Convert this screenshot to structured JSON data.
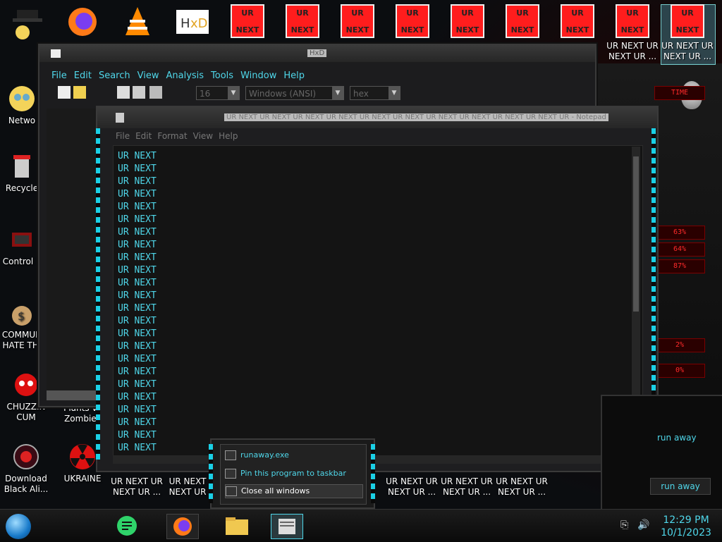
{
  "desktop": {
    "top_row_tiles": [
      "UR",
      "NEXT"
    ],
    "top_labels": [
      {
        "line1": "UR NEXT UR",
        "line2": "NEXT UR ..."
      },
      {
        "line1": "UR NEXT UR",
        "line2": "NEXT UR ..."
      }
    ],
    "left_icons": [
      {
        "label": "Netwo"
      },
      {
        "label": "Recycle"
      },
      {
        "label": "Control P"
      },
      {
        "label": "COMMUN",
        "label2": "HATE THI"
      },
      {
        "label": "CHUZZIN",
        "label2": "CUM"
      },
      {
        "label": "Plants vs",
        "label2": "Zombies"
      },
      {
        "label": "Download",
        "label2": "Black Ali..."
      },
      {
        "label": "UKRAINE"
      }
    ],
    "bottom_labels": [
      {
        "line1": "UR NEXT UR",
        "line2": "NEXT UR ..."
      },
      {
        "line1": "UR NEXT",
        "line2": "NEXT UR"
      },
      {
        "line1": "UR NEXT UR",
        "line2": "NEXT UR ..."
      },
      {
        "line1": "UR NEXT UR",
        "line2": "NEXT UR ..."
      },
      {
        "line1": "UR NEXT UR",
        "line2": "NEXT UR ..."
      }
    ],
    "right_panel": {
      "time_label": "TIME",
      "pct1": "63%",
      "pct2": "64%",
      "pct3": "87%",
      "pct4": "2%",
      "pct5": "0%"
    },
    "run_away_label": "run away",
    "run_away_button": "run away"
  },
  "hex_editor": {
    "title": "HxD",
    "menu": [
      "File",
      "Edit",
      "Search",
      "View",
      "Analysis",
      "Tools",
      "Window",
      "Help"
    ],
    "bytes_per_row": "16",
    "charset": "Windows (ANSI)",
    "offset_base": "hex"
  },
  "notepad": {
    "title": "UR NEXT UR NEXT UR NEXT UR NEXT UR NEXT UR NEXT UR NEXT UR NEXT UR NEXT UR NEXT UR - Notepad",
    "menu": [
      "File",
      "Edit",
      "Format",
      "View",
      "Help"
    ],
    "lines": [
      "UR NEXT",
      "UR NEXT",
      "UR NEXT",
      "UR NEXT",
      "UR NEXT",
      "UR NEXT",
      "UR NEXT",
      "UR NEXT",
      "UR NEXT",
      "UR NEXT",
      "UR NEXT",
      "UR NEXT",
      "UR NEXT",
      "UR NEXT",
      "UR NEXT",
      "UR NEXT",
      "UR NEXT",
      "UR NEXT",
      "UR NEXT",
      "UR NEXT",
      "UR NEXT",
      "UR NEXT",
      "UR NEXT",
      "UR NEXT"
    ]
  },
  "jump_list": {
    "items": [
      {
        "label": "runaway.exe",
        "icon": "window-icon"
      },
      {
        "label": "Pin this program to taskbar",
        "icon": "pin-icon"
      },
      {
        "label": "Close all windows",
        "icon": "close-icon"
      }
    ]
  },
  "taskbar": {
    "time": "12:29 PM",
    "date": "10/1/2023"
  },
  "colors": {
    "accent": "#4fd7ea",
    "tile_red": "#ff1d1d"
  }
}
